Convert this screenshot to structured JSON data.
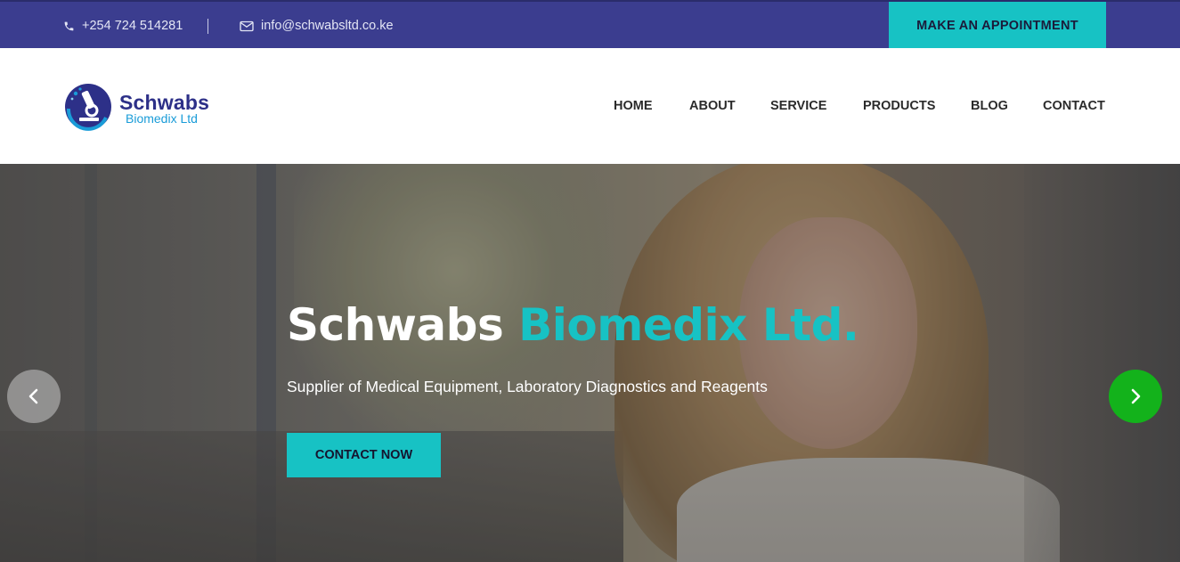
{
  "topbar": {
    "phone": "+254 724 514281",
    "email": "info@schwabsltd.co.ke",
    "appointment_label": "MAKE AN APPOINTMENT"
  },
  "logo": {
    "name": "Schwabs",
    "subtitle": "Biomedix Ltd"
  },
  "nav": {
    "items": [
      {
        "label": "HOME"
      },
      {
        "label": "ABOUT"
      },
      {
        "label": "SERVICE"
      },
      {
        "label": "PRODUCTS"
      },
      {
        "label": "BLOG"
      },
      {
        "label": "CONTACT"
      }
    ]
  },
  "hero": {
    "title_main": "Schwabs ",
    "title_accent": "Biomedix Ltd.",
    "subtitle": "Supplier of Medical Equipment, Laboratory Diagnostics and Reagents",
    "cta_label": "CONTACT NOW"
  },
  "icons": {
    "phone": "phone-icon",
    "email": "envelope-icon",
    "prev": "chevron-left-icon",
    "next": "chevron-right-icon",
    "logo": "microscope-icon"
  },
  "colors": {
    "topbar_bg": "#3b3d8f",
    "accent": "#17c2c4",
    "brand_navy": "#2d3088",
    "next_arrow": "#13b21b"
  }
}
